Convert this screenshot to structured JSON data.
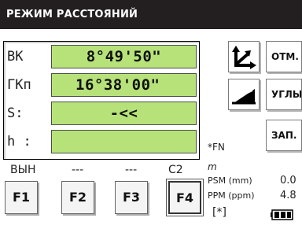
{
  "title": "РЕЖИМ РАССТОЯНИЙ",
  "rows": [
    {
      "label": "ВК",
      "value": "8°49'50\""
    },
    {
      "label": "ГКп",
      "value": "16°38'00\""
    },
    {
      "label": "S:",
      "value": "-<<"
    },
    {
      "label": "h :",
      "value": ""
    }
  ],
  "side_buttons": {
    "otm_label": "ОТМ.",
    "ugly_label": "УГЛЫ",
    "zap_label": "ЗАП."
  },
  "fn_indicator": "*FN",
  "unit": "m",
  "psm_label": "PSM (mm)",
  "psm_value": "0.0",
  "ppm_label": "PPM (ppm)",
  "ppm_value": "4.8",
  "star_indicator": "[*]",
  "function_labels": [
    "ВЫН",
    "---",
    "---",
    "С2"
  ],
  "function_keys": [
    "F1",
    "F2",
    "F3",
    "F4"
  ],
  "active_key": "F4",
  "colors": {
    "display_green": "#b7e27a",
    "title_bg": "#231f20"
  }
}
